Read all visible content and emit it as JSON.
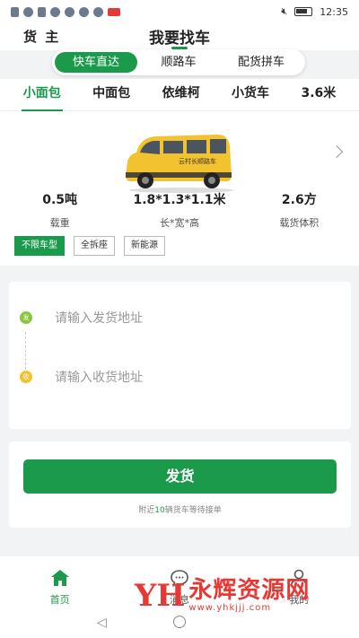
{
  "status_bar": {
    "time": "12:35"
  },
  "header": {
    "role": "货 主",
    "title": "我要找车"
  },
  "mode_tabs": [
    {
      "label": "快车直达",
      "active": true
    },
    {
      "label": "顺路车",
      "active": false
    },
    {
      "label": "配货拼车",
      "active": false
    }
  ],
  "vehicle_types": [
    {
      "label": "小面包",
      "active": true
    },
    {
      "label": "中面包",
      "active": false
    },
    {
      "label": "依维柯",
      "active": false
    },
    {
      "label": "小货车",
      "active": false
    },
    {
      "label": "3.6米",
      "active": false
    }
  ],
  "vehicle": {
    "decal": "云村长顺路车",
    "specs": [
      {
        "value": "0.5吨",
        "label": "载重"
      },
      {
        "value": "1.8*1.3*1.1米",
        "label": "长*宽*高"
      },
      {
        "value": "2.6方",
        "label": "载货体积"
      }
    ],
    "filters": [
      {
        "label": "不限车型",
        "active": true
      },
      {
        "label": "全拆座",
        "active": false
      },
      {
        "label": "新能源",
        "active": false
      }
    ]
  },
  "address": {
    "pickup_marker": "发",
    "pickup_placeholder": "请输入发货地址",
    "dropoff_marker": "收",
    "dropoff_placeholder": "请输入收货地址"
  },
  "ship": {
    "button_label": "发货",
    "nearby_prefix": "附近",
    "nearby_count": "10",
    "nearby_suffix": "辆货车等待接单"
  },
  "bottom_nav": [
    {
      "label": "首页",
      "icon": "home-icon",
      "active": true
    },
    {
      "label": "消息",
      "icon": "chat-icon",
      "active": false
    },
    {
      "label": "我的",
      "icon": "user-icon",
      "active": false
    }
  ],
  "watermark": {
    "logo": "YH",
    "title": "永辉资源网",
    "url": "www.yhkjjj.com"
  },
  "colors": {
    "accent": "#1a9a4a",
    "pickup_dot": "#8cc63f",
    "dropoff_dot": "#f2c230",
    "van": "#f2c230",
    "watermark": "#e53935"
  }
}
